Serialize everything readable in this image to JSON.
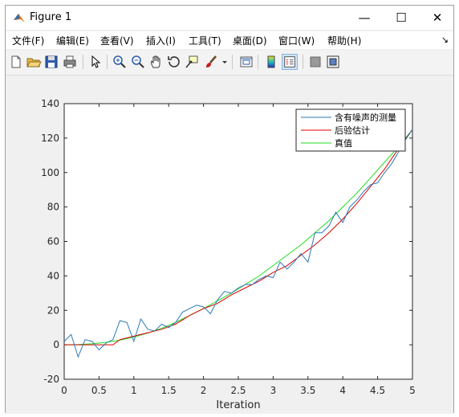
{
  "window": {
    "title": "Figure 1",
    "minimize_glyph": "—",
    "maximize_glyph": "☐",
    "close_glyph": "✕"
  },
  "menu": [
    "文件(F)",
    "编辑(E)",
    "查看(V)",
    "插入(I)",
    "工具(T)",
    "桌面(D)",
    "窗口(W)",
    "帮助(H)"
  ],
  "menu_dock_glyph": "↘",
  "toolbar": {
    "icons": [
      "new-figure-icon",
      "open-file-icon",
      "save-icon",
      "print-icon",
      "pointer-icon",
      "zoom-in-icon",
      "zoom-out-icon",
      "pan-hand-icon",
      "rotate-3d-icon",
      "data-cursor-icon",
      "brush-icon",
      "brush-dropdown-icon",
      "link-plot-icon",
      "colorbar-icon",
      "legend-icon",
      "hide-plot-tools-icon",
      "show-plot-tools-icon"
    ]
  },
  "colors": {
    "noisy": "#2a7ab8",
    "posterior": "#e00000",
    "truth": "#22dd22"
  },
  "chart_data": {
    "type": "line",
    "xlabel": "Iteration",
    "ylabel": "",
    "title": "",
    "xlim": [
      0,
      5
    ],
    "ylim": [
      -20,
      140
    ],
    "xticks": [
      "0",
      "0.5",
      "1",
      "1.5",
      "2",
      "2.5",
      "3",
      "3.5",
      "4",
      "4.5",
      "5"
    ],
    "yticks": [
      "-20",
      "0",
      "20",
      "40",
      "60",
      "80",
      "100",
      "120",
      "140"
    ],
    "legend_position": "top-right",
    "series": [
      {
        "name": "含有噪声的测量",
        "color": "#2a7ab8",
        "x": [
          0,
          0.1,
          0.2,
          0.3,
          0.4,
          0.5,
          0.6,
          0.7,
          0.8,
          0.9,
          1.0,
          1.1,
          1.2,
          1.3,
          1.4,
          1.5,
          1.6,
          1.7,
          1.8,
          1.9,
          2.0,
          2.1,
          2.2,
          2.3,
          2.4,
          2.5,
          2.6,
          2.7,
          2.8,
          2.9,
          3.0,
          3.1,
          3.2,
          3.3,
          3.4,
          3.5,
          3.6,
          3.7,
          3.8,
          3.9,
          4.0,
          4.1,
          4.2,
          4.3,
          4.4,
          4.5,
          4.6,
          4.7,
          4.8,
          4.9,
          5.0
        ],
        "values": [
          2,
          6,
          -7,
          3,
          2,
          -3,
          1,
          3,
          14,
          13,
          2,
          15,
          9,
          8,
          12,
          10,
          13,
          19,
          21,
          23,
          22,
          18,
          26,
          31,
          30,
          33,
          35,
          35,
          38,
          40,
          39,
          48,
          44,
          48,
          53,
          48,
          65,
          65,
          69,
          77,
          71,
          80,
          84,
          89,
          93,
          94,
          100,
          105,
          112,
          119,
          125
        ]
      },
      {
        "name": "后验估计",
        "color": "#e00000",
        "x": [
          0,
          0.2,
          0.4,
          0.6,
          0.7,
          0.8,
          1.0,
          1.2,
          1.4,
          1.6,
          1.8,
          2.0,
          2.2,
          2.4,
          2.6,
          2.8,
          3.0,
          3.2,
          3.4,
          3.6,
          3.8,
          4.0,
          4.2,
          4.4,
          4.6,
          4.8,
          5.0
        ],
        "values": [
          0,
          0,
          0,
          0,
          0,
          3,
          5,
          7,
          9,
          12,
          17,
          21,
          24,
          29,
          33,
          37,
          42,
          46,
          52,
          58,
          65,
          73,
          82,
          92,
          102,
          114,
          125
        ]
      },
      {
        "name": "真值",
        "color": "#22dd22",
        "x": [
          0,
          0.2,
          0.4,
          0.6,
          0.8,
          1.0,
          1.2,
          1.4,
          1.6,
          1.8,
          2.0,
          2.2,
          2.4,
          2.6,
          2.8,
          3.0,
          3.2,
          3.4,
          3.6,
          3.8,
          4.0,
          4.2,
          4.4,
          4.6,
          4.8,
          5.0
        ],
        "values": [
          0,
          0.2,
          0.6,
          1.4,
          2.7,
          4.5,
          6.8,
          9.6,
          13,
          17,
          21,
          25.5,
          30,
          35,
          40,
          46,
          52,
          58,
          65,
          72,
          80,
          88,
          97,
          106,
          115,
          125
        ]
      }
    ]
  }
}
